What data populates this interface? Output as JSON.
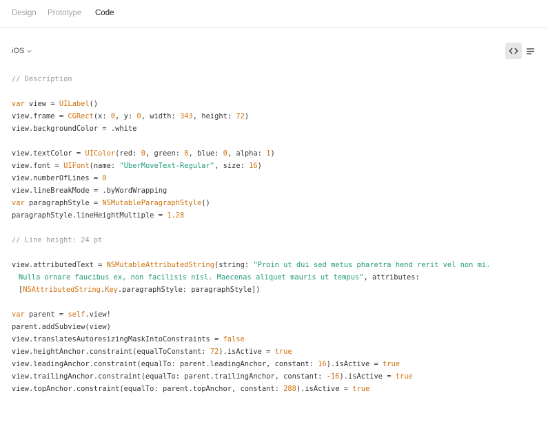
{
  "tabs": [
    {
      "label": "Design",
      "active": false
    },
    {
      "label": "Prototype",
      "active": false
    },
    {
      "label": "Code",
      "active": true
    }
  ],
  "platform": {
    "label": "iOS"
  },
  "colors": {
    "keyword": "#d0700b",
    "string": "#1f9b7b",
    "comment": "#9b9b9b",
    "plain": "#333333"
  },
  "icons": {
    "code_view": "code-brackets-icon",
    "list_view": "text-lines-icon",
    "dropdown": "chevron-down-icon"
  },
  "code_lines": [
    [
      [
        "c",
        "// Description"
      ]
    ],
    [],
    [
      [
        "k",
        "var"
      ],
      [
        "p",
        " view = "
      ],
      [
        "k",
        "UILabel"
      ],
      [
        "p",
        "()"
      ]
    ],
    [
      [
        "p",
        "view.frame = "
      ],
      [
        "k",
        "CGRect"
      ],
      [
        "p",
        "(x: "
      ],
      [
        "k",
        "0"
      ],
      [
        "p",
        ", y: "
      ],
      [
        "k",
        "0"
      ],
      [
        "p",
        ", width: "
      ],
      [
        "k",
        "343"
      ],
      [
        "p",
        ", height: "
      ],
      [
        "k",
        "72"
      ],
      [
        "p",
        ")"
      ]
    ],
    [
      [
        "p",
        "view.backgroundColor = .white"
      ]
    ],
    [],
    [
      [
        "p",
        "view.textColor = "
      ],
      [
        "k",
        "UIColor"
      ],
      [
        "p",
        "(red: "
      ],
      [
        "k",
        "0"
      ],
      [
        "p",
        ", green: "
      ],
      [
        "k",
        "0"
      ],
      [
        "p",
        ", blue: "
      ],
      [
        "k",
        "0"
      ],
      [
        "p",
        ", alpha: "
      ],
      [
        "k",
        "1"
      ],
      [
        "p",
        ")"
      ]
    ],
    [
      [
        "p",
        "view.font = "
      ],
      [
        "k",
        "UIFont"
      ],
      [
        "p",
        "(name: "
      ],
      [
        "s",
        "\"UberMoveText-Regular\""
      ],
      [
        "p",
        ", size: "
      ],
      [
        "k",
        "16"
      ],
      [
        "p",
        ")"
      ]
    ],
    [
      [
        "p",
        "view.numberOfLines = "
      ],
      [
        "k",
        "0"
      ]
    ],
    [
      [
        "p",
        "view.lineBreakMode = .byWordWrapping"
      ]
    ],
    [
      [
        "k",
        "var"
      ],
      [
        "p",
        " paragraphStyle = "
      ],
      [
        "k",
        "NSMutableParagraphStyle"
      ],
      [
        "p",
        "()"
      ]
    ],
    [
      [
        "p",
        "paragraphStyle.lineHeightMultiple = "
      ],
      [
        "k",
        "1.28"
      ]
    ],
    [],
    [
      [
        "c",
        "// Line height: 24 pt"
      ]
    ],
    [],
    [
      [
        "p",
        "view.attributedText = "
      ],
      [
        "k",
        "NSMutableAttributedString"
      ],
      [
        "p",
        "(string: "
      ],
      [
        "s",
        "\"Proin ut dui sed metus pharetra hend rerit vel non mi."
      ]
    ],
    [
      [
        "s",
        "Nulla ornare faucibus ex, non facilisis nisl. Maecenas aliquet mauris ut tempus\""
      ],
      [
        "p",
        ", attributes:"
      ]
    ],
    [
      [
        "p",
        "["
      ],
      [
        "k",
        "NSAttributedString"
      ],
      [
        "p",
        "."
      ],
      [
        "k",
        "Key"
      ],
      [
        "p",
        ".paragraphStyle: paragraphStyle])"
      ]
    ],
    [],
    [
      [
        "k",
        "var"
      ],
      [
        "p",
        " parent = "
      ],
      [
        "k",
        "self"
      ],
      [
        "p",
        ".view!"
      ]
    ],
    [
      [
        "p",
        "parent.addSubview(view)"
      ]
    ],
    [
      [
        "p",
        "view.translatesAutoresizingMaskIntoConstraints = "
      ],
      [
        "k",
        "false"
      ]
    ],
    [
      [
        "p",
        "view.heightAnchor.constraint(equalToConstant: "
      ],
      [
        "k",
        "72"
      ],
      [
        "p",
        ").isActive = "
      ],
      [
        "k",
        "true"
      ]
    ],
    [
      [
        "p",
        "view.leadingAnchor.constraint(equalTo: parent.leadingAnchor, constant: "
      ],
      [
        "k",
        "16"
      ],
      [
        "p",
        ").isActive = "
      ],
      [
        "k",
        "true"
      ]
    ],
    [
      [
        "p",
        "view.trailingAnchor.constraint(equalTo: parent.trailingAnchor, constant: -"
      ],
      [
        "k",
        "16"
      ],
      [
        "p",
        ").isActive = "
      ],
      [
        "k",
        "true"
      ]
    ],
    [
      [
        "p",
        "view.topAnchor.constraint(equalTo: parent.topAnchor, constant: "
      ],
      [
        "k",
        "288"
      ],
      [
        "p",
        ").isActive = "
      ],
      [
        "k",
        "true"
      ]
    ]
  ]
}
